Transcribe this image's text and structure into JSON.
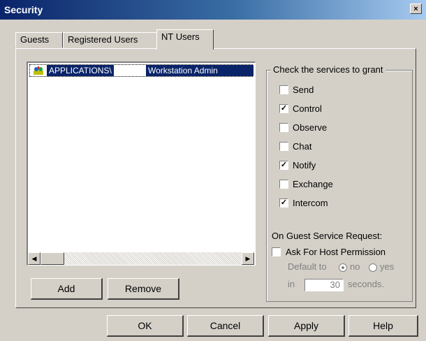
{
  "window": {
    "title": "Security",
    "close_glyph": "×"
  },
  "tabs": [
    {
      "label": "Guests",
      "active": false
    },
    {
      "label": "Registered Users",
      "active": false
    },
    {
      "label": "NT Users",
      "active": true
    }
  ],
  "user_list": {
    "rows": [
      {
        "icon": "nt-users-group-icon",
        "name": "APPLICATIONS\\",
        "user": "Workstation Admin"
      }
    ]
  },
  "list_buttons": {
    "add": "Add",
    "remove": "Remove"
  },
  "services": {
    "legend": "Check the services to grant",
    "items": [
      {
        "label": "Send",
        "checked": false
      },
      {
        "label": "Control",
        "checked": true
      },
      {
        "label": "Observe",
        "checked": false
      },
      {
        "label": "Chat",
        "checked": false
      },
      {
        "label": "Notify",
        "checked": true
      },
      {
        "label": "Exchange",
        "checked": false
      },
      {
        "label": "Intercom",
        "checked": true
      }
    ],
    "guest_request_label": "On Guest Service Request:",
    "ask_permission": {
      "label": "Ask For Host Permission",
      "checked": false
    },
    "default_to_label": "Default to",
    "radio_no": "no",
    "radio_yes": "yes",
    "radio_selected": "no",
    "in_label": "in",
    "seconds_value": "30",
    "seconds_label": "seconds."
  },
  "dialog_buttons": {
    "ok": "OK",
    "cancel": "Cancel",
    "apply": "Apply",
    "help": "Help"
  }
}
